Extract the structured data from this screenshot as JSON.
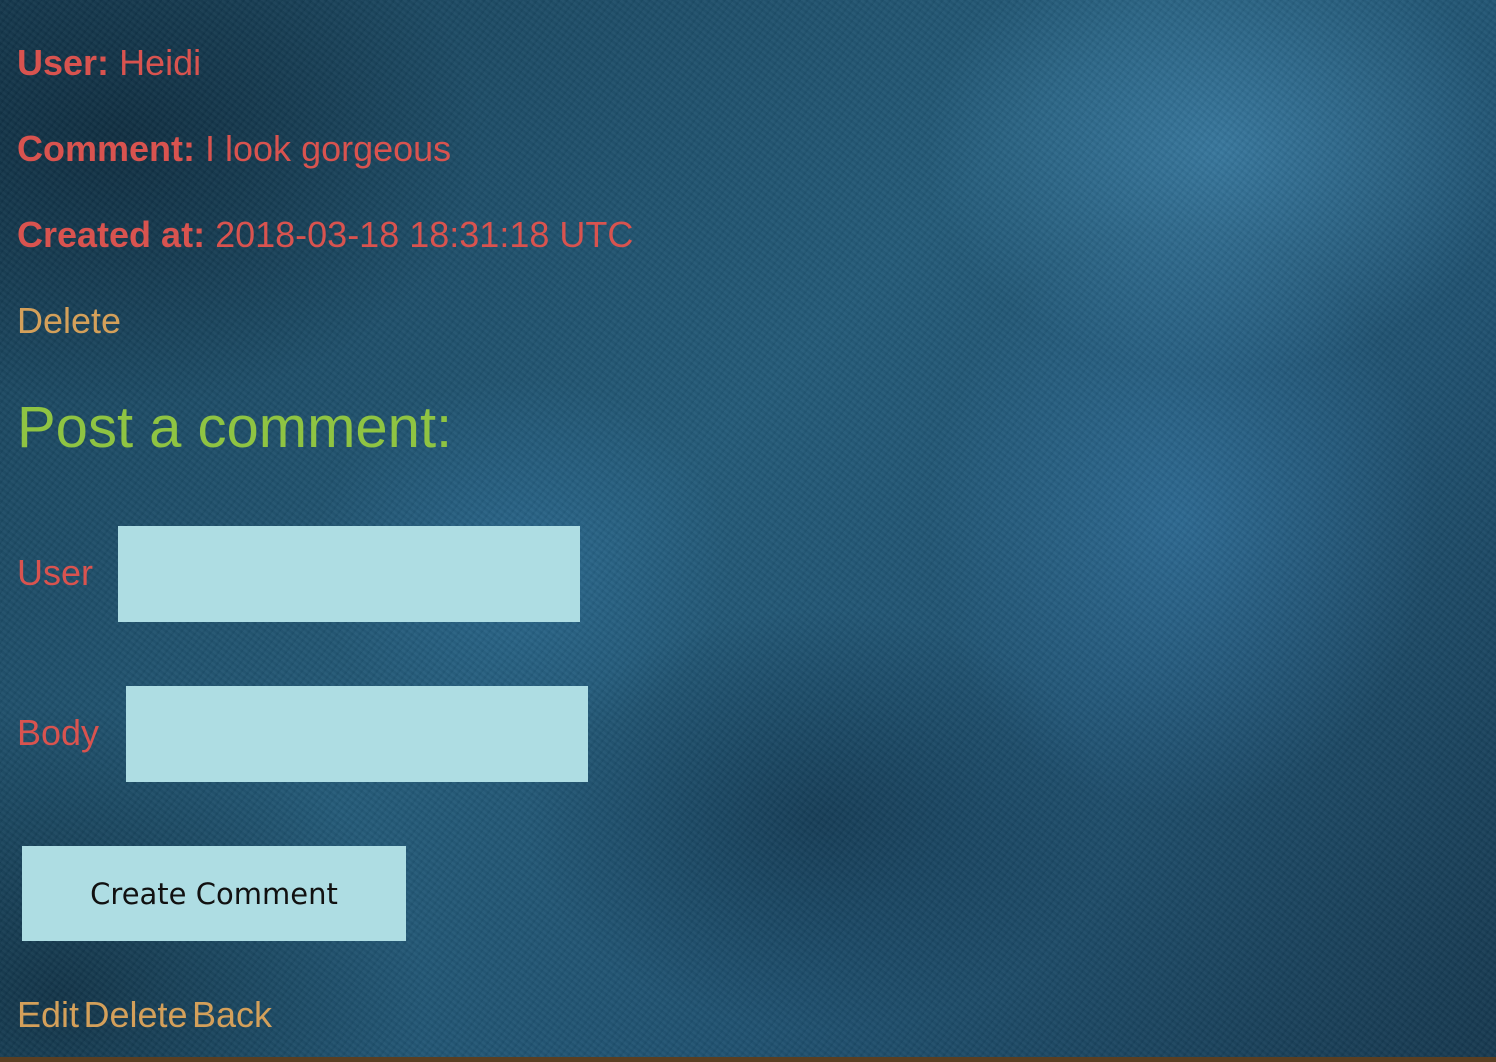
{
  "comment": {
    "user_label": "User:",
    "user_value": "Heidi",
    "comment_label": "Comment:",
    "comment_value": "I look gorgeous",
    "created_label": "Created at:",
    "created_value": "2018-03-18 18:31:18 UTC",
    "delete_link": "Delete"
  },
  "form": {
    "heading": "Post a comment:",
    "user_label": "User",
    "user_value": "",
    "body_label": "Body",
    "body_value": "",
    "submit_label": "Create Comment"
  },
  "footer": {
    "edit_link": "Edit",
    "delete_link": "Delete",
    "back_link": "Back"
  },
  "colors": {
    "label_red": "#d9534f",
    "link_gold": "#d4a05a",
    "heading_green": "#8fc442",
    "input_bg": "#aedde3"
  }
}
